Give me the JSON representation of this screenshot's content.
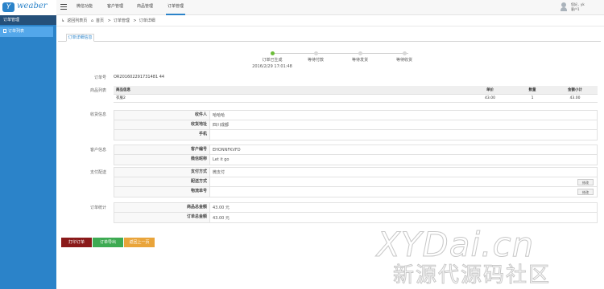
{
  "brand": {
    "logo_letter": "Y",
    "logo_text": "weaber"
  },
  "sidebar": {
    "section": "订单管理",
    "items": [
      {
        "label": "订单列表"
      }
    ]
  },
  "topnav": {
    "items": [
      "微信功能",
      "客户管理",
      "商品管理",
      "订单管理"
    ],
    "active": "订单管理"
  },
  "user": {
    "name": "您好，yk",
    "role": "客户1"
  },
  "breadcrumb": {
    "back": "返回列表页",
    "home": "首页",
    "sep": ">",
    "level1": "订单管理",
    "current": "订单详细"
  },
  "tab": {
    "label": "订单详细信息"
  },
  "steps": {
    "items": [
      "订单已生成",
      "等待付款",
      "等待发货",
      "等待收货"
    ],
    "active_index": 0,
    "time": "2016/2/29 17:01:48"
  },
  "order": {
    "label": "订单号",
    "number": "OR201602291731481 44"
  },
  "products": {
    "section_label": "商品列表",
    "headers": [
      "商品信息",
      "单价",
      "数量",
      "金额小计"
    ],
    "rows": [
      {
        "name": "衣服2",
        "price": "43.00",
        "qty": "1",
        "subtotal": "43.00"
      }
    ]
  },
  "receiver": {
    "section_label": "收货信息",
    "rows": [
      {
        "key": "收件人",
        "value": "哈哈哈"
      },
      {
        "key": "收货地址",
        "value": "四川成都"
      },
      {
        "key": "手机",
        "value": ""
      }
    ]
  },
  "customer": {
    "section_label": "客户信息",
    "rows": [
      {
        "key": "客户编号",
        "value": "EHONNFKVFD"
      },
      {
        "key": "微信昵称",
        "value": "Let it go"
      }
    ]
  },
  "payment": {
    "section_label": "支付配送",
    "rows": [
      {
        "key": "支付方式",
        "value": "微支付",
        "button": ""
      },
      {
        "key": "配送方式",
        "value": "",
        "button": "修改"
      },
      {
        "key": "物流单号",
        "value": "",
        "button": "修改"
      }
    ]
  },
  "totals": {
    "section_label": "订单统计",
    "rows": [
      {
        "key": "商品总金额",
        "value": "43.00 元"
      },
      {
        "key": "订单总金额",
        "value": "43.00 元"
      }
    ]
  },
  "actions": {
    "print": "打印订单",
    "export": "订单导出",
    "back": "返回上一页"
  },
  "watermark": {
    "line1": "XYDai.cn",
    "line2": "新源代源码社区"
  },
  "colors": {
    "sidebar": "#2b83c9",
    "sidebar_active": "#53a7ea",
    "step_active": "#6cbd39",
    "print": "#8a1a1a",
    "export": "#3daa52",
    "back": "#e9a43a"
  }
}
